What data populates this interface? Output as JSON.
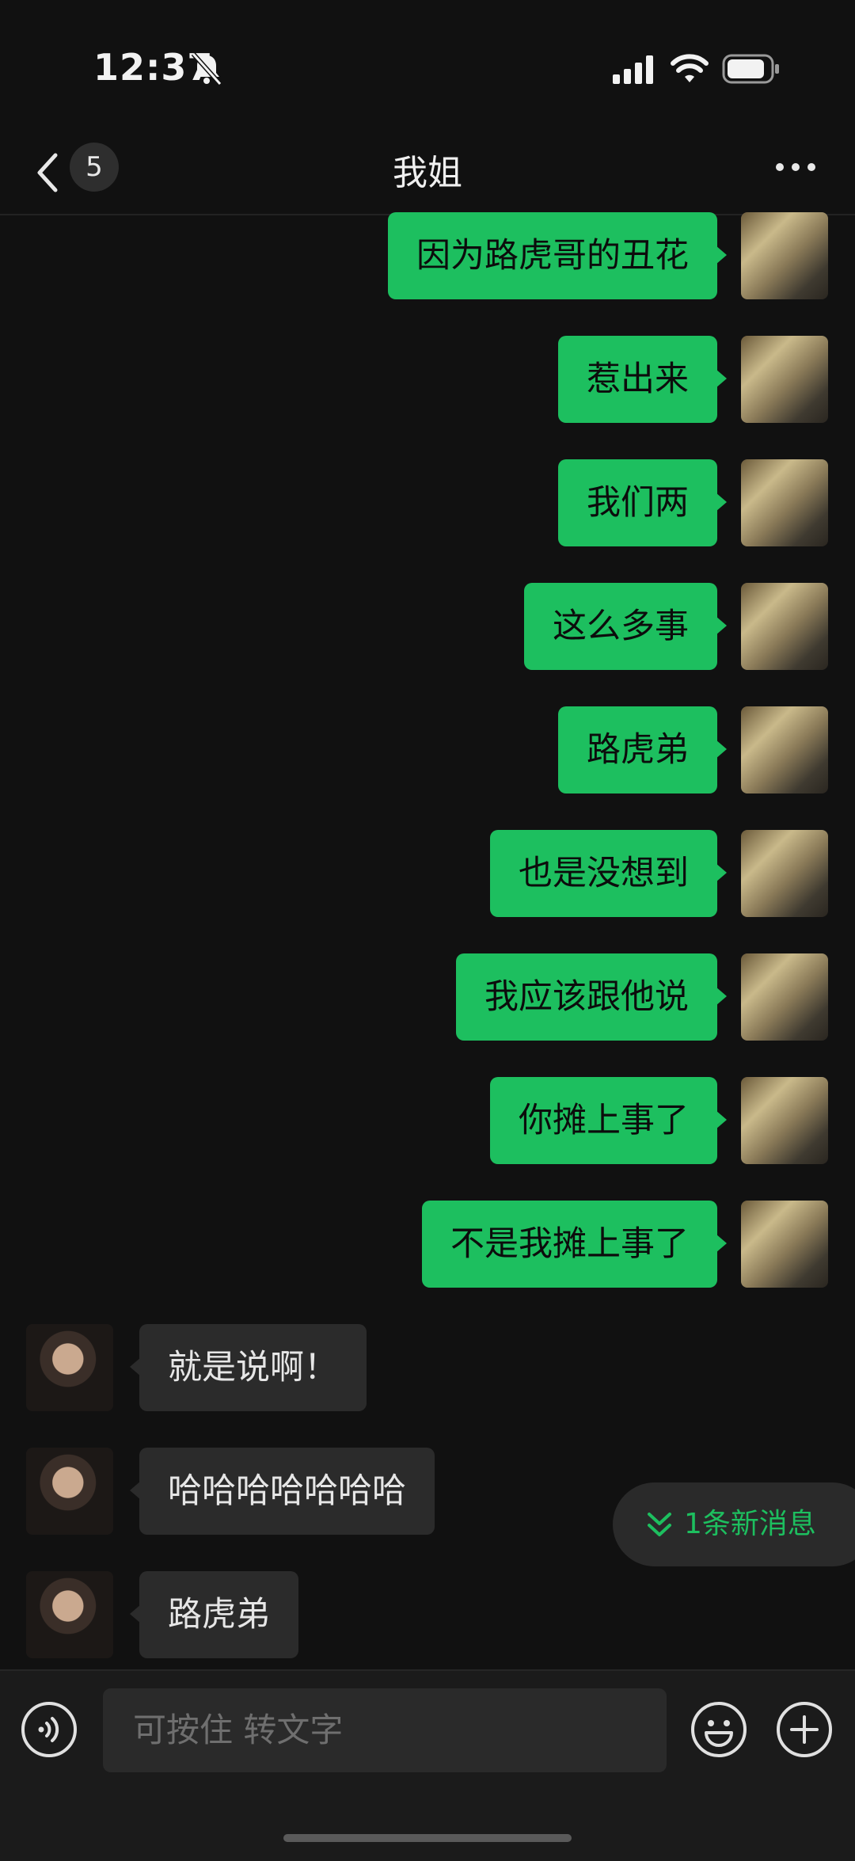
{
  "status": {
    "time": "12:37"
  },
  "header": {
    "back_count": "5",
    "title": "我姐"
  },
  "messages": [
    {
      "side": "out",
      "text": "因为路虎哥的丑花"
    },
    {
      "side": "out",
      "text": "惹出来"
    },
    {
      "side": "out",
      "text": "我们两"
    },
    {
      "side": "out",
      "text": "这么多事"
    },
    {
      "side": "out",
      "text": "路虎弟"
    },
    {
      "side": "out",
      "text": "也是没想到"
    },
    {
      "side": "out",
      "text": "我应该跟他说"
    },
    {
      "side": "out",
      "text": "你摊上事了"
    },
    {
      "side": "out",
      "text": "不是我摊上事了"
    },
    {
      "side": "in",
      "text": "就是说啊！"
    },
    {
      "side": "in",
      "text": "哈哈哈哈哈哈哈"
    },
    {
      "side": "in",
      "text": "路虎弟"
    }
  ],
  "new_messages": {
    "label": "1条新消息",
    "icon": "double-chevron-down-icon"
  },
  "input": {
    "placeholder": "可按住 转文字"
  },
  "colors": {
    "background": "#111111",
    "outgoing_bubble": "#1dbf5f",
    "incoming_bubble": "#2b2b2b",
    "accent": "#1dbf5f"
  }
}
